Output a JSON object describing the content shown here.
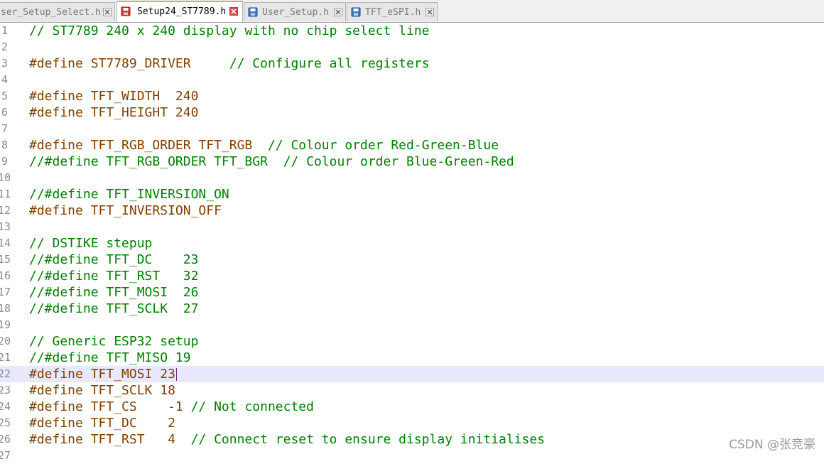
{
  "tabs": [
    {
      "title": "ser_Setup_Select.h",
      "icon": "saved-file-icon",
      "active": false
    },
    {
      "title": "Setup24_ST7789.h",
      "icon": "unsaved-file-icon",
      "active": true
    },
    {
      "title": "User_Setup.h",
      "icon": "saved-file-icon",
      "active": false
    },
    {
      "title": "TFT_eSPI.h",
      "icon": "saved-file-icon",
      "active": false
    }
  ],
  "editor": {
    "current_line": 22,
    "lines": [
      {
        "n": "1",
        "text": "// ST7789 240 x 240 display with no chip select line",
        "kind": "comment"
      },
      {
        "n": "2",
        "text": "",
        "kind": "blank"
      },
      {
        "n": "3",
        "text": "#define ST7789_DRIVER     ",
        "comment": "// Configure all registers",
        "kind": "pre"
      },
      {
        "n": "4",
        "text": "",
        "kind": "blank"
      },
      {
        "n": "5",
        "text": "#define TFT_WIDTH  240",
        "kind": "pre"
      },
      {
        "n": "6",
        "text": "#define TFT_HEIGHT 240",
        "kind": "pre"
      },
      {
        "n": "7",
        "text": "",
        "kind": "blank"
      },
      {
        "n": "8",
        "text": "#define TFT_RGB_ORDER TFT_RGB  ",
        "comment": "// Colour order Red-Green-Blue",
        "kind": "pre"
      },
      {
        "n": "9",
        "text": "//#define TFT_RGB_ORDER TFT_BGR  // Colour order Blue-Green-Red",
        "kind": "comment"
      },
      {
        "n": "10",
        "text": "",
        "kind": "blank"
      },
      {
        "n": "11",
        "text": "//#define TFT_INVERSION_ON",
        "kind": "comment"
      },
      {
        "n": "12",
        "text": "#define TFT_INVERSION_OFF",
        "kind": "pre"
      },
      {
        "n": "13",
        "text": "",
        "kind": "blank"
      },
      {
        "n": "14",
        "text": "// DSTIKE stepup",
        "kind": "comment"
      },
      {
        "n": "15",
        "text": "//#define TFT_DC    23",
        "kind": "comment"
      },
      {
        "n": "16",
        "text": "//#define TFT_RST   32",
        "kind": "comment"
      },
      {
        "n": "17",
        "text": "//#define TFT_MOSI  26",
        "kind": "comment"
      },
      {
        "n": "18",
        "text": "//#define TFT_SCLK  27",
        "kind": "comment"
      },
      {
        "n": "19",
        "text": "",
        "kind": "blank"
      },
      {
        "n": "20",
        "text": "// Generic ESP32 setup",
        "kind": "comment"
      },
      {
        "n": "21",
        "text": "//#define TFT_MISO 19",
        "kind": "comment"
      },
      {
        "n": "22",
        "text": "#define TFT_MOSI 23",
        "kind": "pre"
      },
      {
        "n": "23",
        "text": "#define TFT_SCLK 18",
        "kind": "pre"
      },
      {
        "n": "24",
        "text": "#define TFT_CS    -1 ",
        "comment": "// Not connected",
        "kind": "pre"
      },
      {
        "n": "25",
        "text": "#define TFT_DC    2",
        "kind": "pre"
      },
      {
        "n": "26",
        "text": "#define TFT_RST   4  ",
        "comment": "// Connect reset to ensure display initialises",
        "kind": "pre"
      },
      {
        "n": "27",
        "text": "",
        "kind": "blank"
      }
    ]
  },
  "watermark": "CSDN @张竞豪",
  "colors": {
    "comment": "#008000",
    "preprocessor": "#804000",
    "current_line": "#e8e8ff",
    "active_tab_accent": "#f2a640"
  }
}
